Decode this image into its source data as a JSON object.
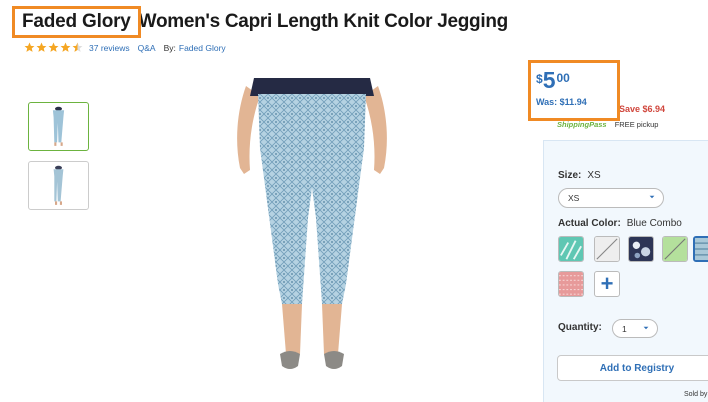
{
  "product": {
    "brand": "Faded Glory",
    "title": "Women's Capri Length Knit Color Jegging"
  },
  "rating": {
    "stars": 4.5,
    "reviews_text": "37 reviews",
    "qa_text": "Q&A",
    "by_label": "By:",
    "by_value": "Faded Glory"
  },
  "colors": {
    "accent": "#2f6fb6",
    "highlight_box": "#f08a24",
    "save": "#d0463c",
    "shipping_pass": "#6cb33f",
    "star": "#f5a623"
  },
  "price": {
    "currency": "$",
    "dollars": "5",
    "cents": "00",
    "was": "Was: $11.94",
    "save": "Save $6.94",
    "shipping_pass": "ShippingPass",
    "pickup": "FREE pickup"
  },
  "size": {
    "label": "Size:",
    "value": "XS",
    "selected_option": "XS"
  },
  "color": {
    "label": "Actual Color:",
    "value": "Blue Combo",
    "swatches": [
      "teal-pattern-swatch",
      "unavailable-swatch",
      "navy-floral-swatch",
      "unavailable-green-swatch",
      "blue-combo-swatch",
      "coral-pattern-swatch"
    ],
    "more_label": "+"
  },
  "quantity": {
    "label": "Quantity:",
    "value": "1"
  },
  "actions": {
    "add_to_registry": "Add to Registry",
    "sold_by": "Sold by"
  },
  "icons": {
    "chevron": "chevron-down-icon",
    "star": "star-icon"
  }
}
